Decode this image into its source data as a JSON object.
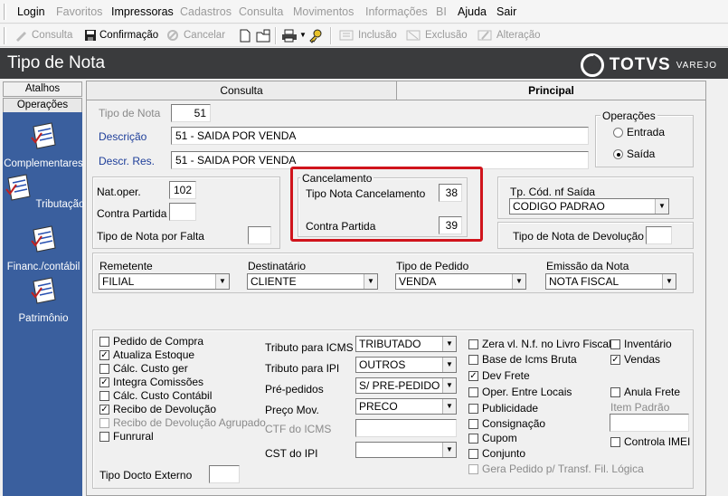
{
  "menu": {
    "items": [
      {
        "label": "Login",
        "enabled": true
      },
      {
        "label": "Favoritos",
        "enabled": false
      },
      {
        "label": "Impressoras",
        "enabled": true
      },
      {
        "label": "Cadastros",
        "enabled": false
      },
      {
        "label": "Consulta",
        "enabled": false
      },
      {
        "label": "Movimentos",
        "enabled": false
      },
      {
        "label": "Informações",
        "enabled": false
      },
      {
        "label": "BI",
        "enabled": false
      },
      {
        "label": "Ajuda",
        "enabled": true
      },
      {
        "label": "Sair",
        "enabled": true
      }
    ]
  },
  "toolbar": {
    "consulta": "Consulta",
    "confirmacao": "Confirmação",
    "cancelar": "Cancelar",
    "inclusao": "Inclusão",
    "exclusao": "Exclusão",
    "alteracao": "Alteração"
  },
  "title": {
    "text": "Tipo de Nota",
    "brand": "TOTVS",
    "brand_sub": "VAREJO"
  },
  "left": {
    "atalhos": "Atalhos",
    "operacoes": "Operações",
    "items": [
      "Complementares",
      "Tributação",
      "Financ./contábil",
      "Patrimônio"
    ]
  },
  "tabs": {
    "consulta": "Consulta",
    "principal": "Principal"
  },
  "form": {
    "tipo_nota_label": "Tipo de Nota",
    "tipo_nota_value": "51",
    "descricao_label": "Descrição",
    "descricao_value": "51 - SAIDA POR VENDA",
    "descr_res_label": "Descr. Res.",
    "descr_res_value": "51 - SAIDA POR VENDA",
    "operacoes_legend": "Operações",
    "entrada": "Entrada",
    "saida": "Saída",
    "nat_oper_label": "Nat.oper.",
    "nat_oper_value": "102",
    "contra_partida_label": "Contra Partida",
    "contra_partida_value": "",
    "tipo_nota_falta_label": "Tipo de Nota por Falta",
    "tipo_nota_falta_value": "",
    "cancelamento_legend": "Cancelamento",
    "tipo_nota_cancel_label": "Tipo Nota Cancelamento",
    "tipo_nota_cancel_value": "38",
    "cancel_contra_label": "Contra Partida",
    "cancel_contra_value": "39",
    "tp_cod_label": "Tp. Cód. nf Saída",
    "tp_cod_value": "CODIGO PADRAO",
    "tipo_devolucao_label": "Tipo de Nota de Devolução",
    "tipo_devolucao_value": "",
    "remetente_label": "Remetente",
    "remetente_value": "FILIAL",
    "destinatario_label": "Destinatário",
    "destinatario_value": "CLIENTE",
    "tipo_pedido_label": "Tipo de Pedido",
    "tipo_pedido_value": "VENDA",
    "emissao_label": "Emissão da Nota",
    "emissao_value": "NOTA FISCAL"
  },
  "checks_left": [
    {
      "label": "Pedido de Compra",
      "checked": false,
      "enabled": true
    },
    {
      "label": "Atualiza Estoque",
      "checked": true,
      "enabled": true
    },
    {
      "label": "Cálc. Custo ger",
      "checked": false,
      "enabled": true
    },
    {
      "label": "Integra Comissões",
      "checked": true,
      "enabled": true
    },
    {
      "label": "Cálc. Custo Contábil",
      "checked": false,
      "enabled": true
    },
    {
      "label": "Recibo de Devolução",
      "checked": true,
      "enabled": true
    },
    {
      "label": "Recibo de Devolução Agrupado",
      "checked": false,
      "enabled": false
    },
    {
      "label": "Funrural",
      "checked": false,
      "enabled": true
    }
  ],
  "tipo_docto_label": "Tipo Docto Externo",
  "middle": {
    "tributo_icms_label": "Tributo para ICMS",
    "tributo_icms_value": "TRIBUTADO",
    "tributo_ipi_label": "Tributo para IPI",
    "tributo_ipi_value": "OUTROS",
    "pre_pedidos_label": "Pré-pedidos",
    "pre_pedidos_value": "S/ PRE-PEDIDO",
    "preco_label": "Preço Mov.",
    "preco_value": "PRECO",
    "ctf_label": "CTF do ICMS",
    "cst_label": "CST do IPI"
  },
  "checks_mid": [
    {
      "label": "Zera vl. N.f. no Livro Fiscal",
      "checked": false,
      "enabled": true
    },
    {
      "label": "Base de Icms Bruta",
      "checked": false,
      "enabled": true
    },
    {
      "label": "Dev Frete",
      "checked": true,
      "enabled": true
    },
    {
      "label": "Oper. Entre Locais",
      "checked": false,
      "enabled": true
    },
    {
      "label": "Publicidade",
      "checked": false,
      "enabled": true
    },
    {
      "label": "Consignação",
      "checked": false,
      "enabled": true
    },
    {
      "label": "Cupom",
      "checked": false,
      "enabled": true
    },
    {
      "label": "Conjunto",
      "checked": false,
      "enabled": true
    },
    {
      "label": "Gera Pedido p/ Transf. Fil. Lógica",
      "checked": false,
      "enabled": false
    }
  ],
  "checks_right": [
    {
      "label": "Inventário",
      "checked": false
    },
    {
      "label": "Vendas",
      "checked": true
    },
    {
      "label": "Anula Frete",
      "checked": false
    }
  ],
  "item_padrao_label": "Item Padrão",
  "controla_imei": "Controla IMEI"
}
